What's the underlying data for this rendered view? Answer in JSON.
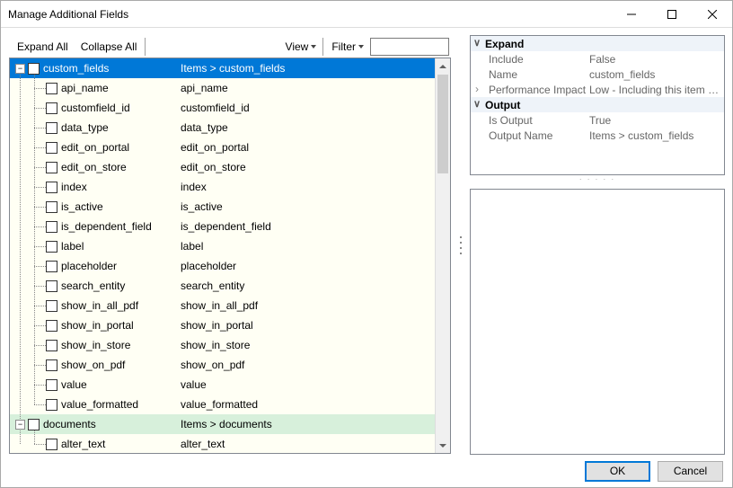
{
  "window": {
    "title": "Manage Additional Fields"
  },
  "toolbar": {
    "expand_all": "Expand All",
    "collapse_all": "Collapse All",
    "view": "View",
    "filter": "Filter",
    "filter_value": ""
  },
  "tree": {
    "root": {
      "name": "custom_fields",
      "path": "Items > custom_fields",
      "children": [
        {
          "name": "api_name",
          "path": "api_name"
        },
        {
          "name": "customfield_id",
          "path": "customfield_id"
        },
        {
          "name": "data_type",
          "path": "data_type"
        },
        {
          "name": "edit_on_portal",
          "path": "edit_on_portal"
        },
        {
          "name": "edit_on_store",
          "path": "edit_on_store"
        },
        {
          "name": "index",
          "path": "index"
        },
        {
          "name": "is_active",
          "path": "is_active"
        },
        {
          "name": "is_dependent_field",
          "path": "is_dependent_field"
        },
        {
          "name": "label",
          "path": "label"
        },
        {
          "name": "placeholder",
          "path": "placeholder"
        },
        {
          "name": "search_entity",
          "path": "search_entity"
        },
        {
          "name": "show_in_all_pdf",
          "path": "show_in_all_pdf"
        },
        {
          "name": "show_in_portal",
          "path": "show_in_portal"
        },
        {
          "name": "show_in_store",
          "path": "show_in_store"
        },
        {
          "name": "show_on_pdf",
          "path": "show_on_pdf"
        },
        {
          "name": "value",
          "path": "value"
        },
        {
          "name": "value_formatted",
          "path": "value_formatted"
        }
      ]
    },
    "sibling": {
      "name": "documents",
      "path": "Items > documents",
      "children": [
        {
          "name": "alter_text",
          "path": "alter_text"
        }
      ]
    }
  },
  "props": {
    "cat_expand": "Expand",
    "include_k": "Include",
    "include_v": "False",
    "name_k": "Name",
    "name_v": "custom_fields",
    "perf_k": "Performance Impact",
    "perf_v": "Low - Including this item will have",
    "cat_output": "Output",
    "isout_k": "Is Output",
    "isout_v": "True",
    "outname_k": "Output Name",
    "outname_v": "Items > custom_fields"
  },
  "footer": {
    "ok": "OK",
    "cancel": "Cancel"
  }
}
